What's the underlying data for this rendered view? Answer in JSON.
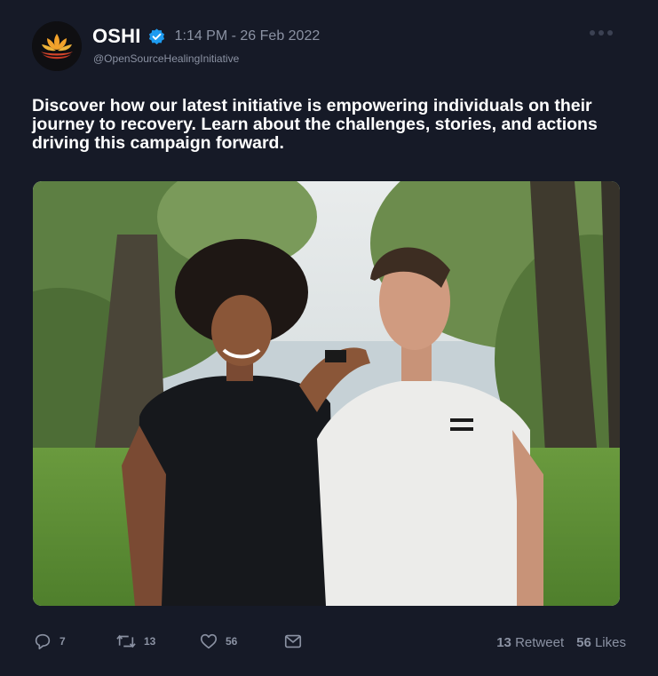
{
  "author": {
    "name": "OSHI",
    "handle": "@OpenSourceHealingInitiative",
    "verified": true,
    "avatar_icon": "lotus-logo"
  },
  "timestamp": "1:14 PM - 26 Feb 2022",
  "tweet_text": "Discover how our latest initiative is empowering individuals on their journey to recovery. Learn about the challenges, stories, and actions driving this campaign forward.",
  "actions": {
    "reply_count": "7",
    "retweet_count": "13",
    "like_count": "56"
  },
  "stats": {
    "retweets_value": "13",
    "retweets_label": "Retweet",
    "likes_value": "56",
    "likes_label": "Likes"
  },
  "colors": {
    "background": "#161a27",
    "muted_text": "#8b92a3",
    "verified_blue": "#1d9bf0",
    "logo_orange": "#f2a22b",
    "logo_red": "#d6452b"
  },
  "icons": [
    "reply-icon",
    "retweet-icon",
    "like-icon",
    "share-icon",
    "verified-badge-icon",
    "more-options-icon"
  ]
}
